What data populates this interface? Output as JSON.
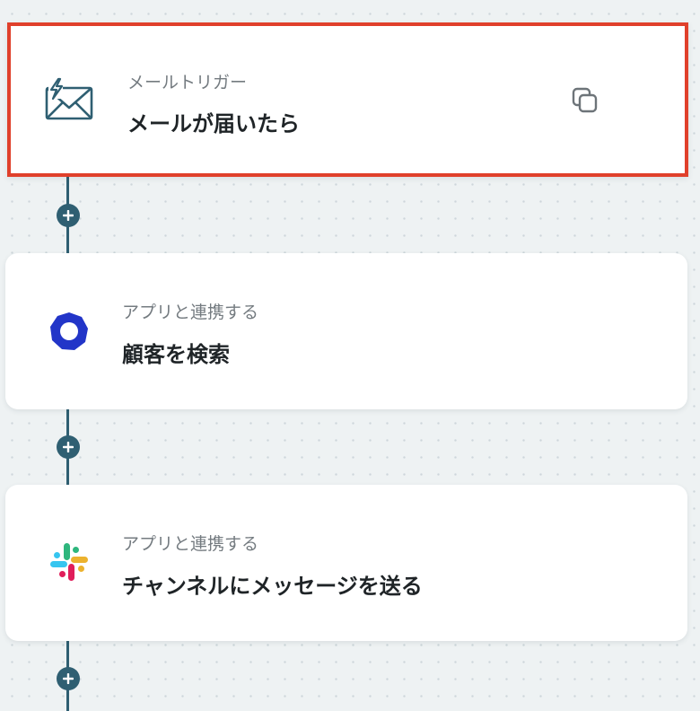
{
  "flow": {
    "steps": [
      {
        "subtitle": "メールトリガー",
        "title": "メールが届いたら",
        "icon": "mail-trigger-icon",
        "selected": true
      },
      {
        "subtitle": "アプリと連携する",
        "title": "顧客を検索",
        "icon": "app-logo-icon"
      },
      {
        "subtitle": "アプリと連携する",
        "title": "チャンネルにメッセージを送る",
        "icon": "slack-icon"
      }
    ],
    "colors": {
      "connector": "#2f5f72",
      "selected_border": "#e0402b",
      "app_logo": "#2235c8"
    }
  }
}
